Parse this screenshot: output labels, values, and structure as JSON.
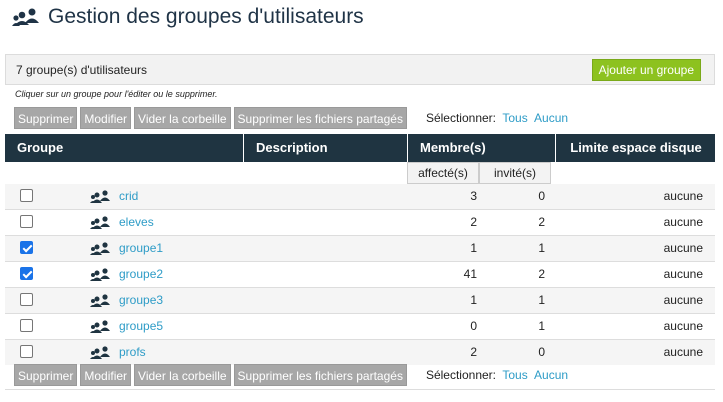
{
  "page": {
    "title": "Gestion des groupes d'utilisateurs"
  },
  "summary": {
    "count_text": "7 groupe(s) d'utilisateurs",
    "add_label": "Ajouter un groupe"
  },
  "hint": "Cliquer sur un groupe pour l'éditer ou le supprimer.",
  "actions": {
    "delete": "Supprimer",
    "modify": "Modifier",
    "empty_trash": "Vider la corbeille",
    "delete_shared": "Supprimer les fichiers partagés",
    "select_label": "Sélectionner:",
    "select_all": "Tous",
    "select_none": "Aucun"
  },
  "table": {
    "headers": {
      "groupe": "Groupe",
      "description": "Description",
      "membres": "Membre(s)",
      "limite": "Limite espace disque"
    },
    "subheaders": {
      "affectes": "affecté(s)",
      "invites": "invité(s)"
    },
    "rows": [
      {
        "name": "crid",
        "checked": false,
        "affectes": "3",
        "invites": "0",
        "limite": "aucune"
      },
      {
        "name": "eleves",
        "checked": false,
        "affectes": "2",
        "invites": "2",
        "limite": "aucune"
      },
      {
        "name": "groupe1",
        "checked": true,
        "affectes": "1",
        "invites": "1",
        "limite": "aucune"
      },
      {
        "name": "groupe2",
        "checked": true,
        "affectes": "41",
        "invites": "2",
        "limite": "aucune"
      },
      {
        "name": "groupe3",
        "checked": false,
        "affectes": "1",
        "invites": "1",
        "limite": "aucune"
      },
      {
        "name": "groupe5",
        "checked": false,
        "affectes": "0",
        "invites": "1",
        "limite": "aucune"
      },
      {
        "name": "profs",
        "checked": false,
        "affectes": "2",
        "invites": "0",
        "limite": "aucune"
      }
    ]
  },
  "colors": {
    "header_bg": "#1f3441",
    "link": "#2e9cc7",
    "add_button": "#8dc21f",
    "action_button": "#a7a7a7",
    "checkbox": "#1a73e8"
  },
  "icons": {
    "title": "users-group-icon",
    "row": "users-group-icon"
  }
}
